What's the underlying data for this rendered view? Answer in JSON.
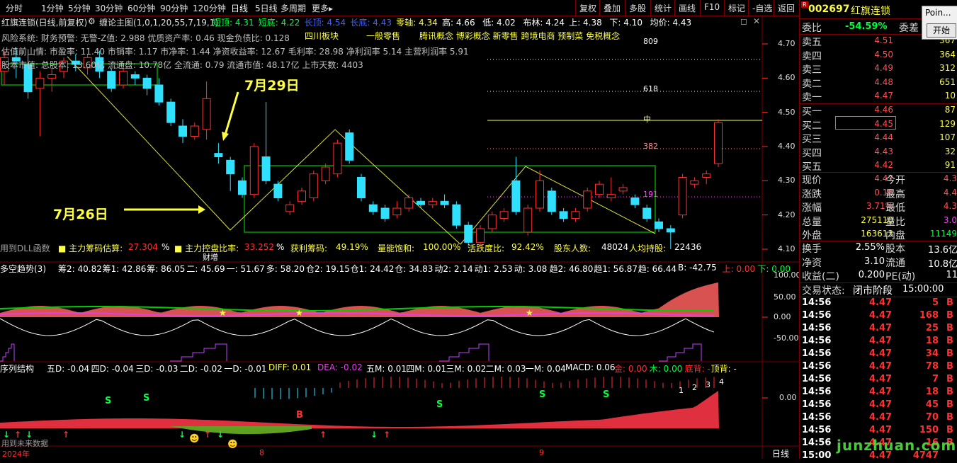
{
  "periods": [
    "分时",
    "1分钟",
    "5分钟",
    "30分钟",
    "60分钟",
    "90分钟",
    "120分钟",
    "日线",
    "5日线",
    "多周期",
    "更多▸"
  ],
  "toolbar": [
    "复权",
    "叠加",
    "多股",
    "统计",
    "画线",
    "F10",
    "标记",
    "-自选",
    "返回"
  ],
  "stock": {
    "code": "002697",
    "name": "红旗连锁",
    "badge": "R"
  },
  "popup": {
    "title": "Poin...",
    "button": "开始"
  },
  "chart_title": "红旗连锁(日线,前复权)",
  "indicator_title": "缠论主图(1,0,1,20,55,7,19,1)",
  "ind_items": [
    "短顶: 4.31",
    "短底: 4.22",
    "长顶: 4.54",
    "长底: 4.43",
    "零轴: 4.34",
    "高: 4.66",
    "低: 4.02",
    "布林: 4.24",
    "上: 4.38",
    "下: 4.10",
    "均价: 4.43"
  ],
  "info_lines": [
    "风险系统: 财务预警: 无警-Z值: 2.988 优质资产率: 0.46 现金负债比: 0.128",
    "估值前山情: 市盈率: 11.40 市销率: 1.17 市净率: 1.44 净资收益率: 12.67 毛利率: 28.98 净利润率 5.14 主营利润率 5.91",
    "股本市值: 总股本: 13.60亿 流通盘: 10.78亿 全流通: 0.79 流通市值: 48.17亿 上市天数: 4403"
  ],
  "concepts": [
    "四川板块",
    "一般零售",
    "腾讯概念 博彩概念 新零售 跨境电商 预制菜 免税概念"
  ],
  "annotations": {
    "jul29": "7月29日",
    "jul26": "7月26日"
  },
  "fib": [
    "809",
    "618",
    "中",
    "382",
    "191"
  ],
  "price_axis": [
    "4.70",
    "4.60",
    "4.50",
    "4.40",
    "4.30",
    "4.20",
    "4.10"
  ],
  "chip_bar": {
    "dll": "用到DLL函数",
    "items": [
      "■ 主力筹码估算:",
      "27.304",
      "%",
      "■ 主力控盘比率:",
      "33.252",
      "%",
      "获利筹码:",
      "49.19%",
      "量能饱和:",
      "100.00%",
      "活跃度比:",
      "92.42%",
      "股东人数:",
      "48024",
      "人均持股:",
      "22436"
    ],
    "tag": "财增"
  },
  "panel2": {
    "title": "多空趋势(3)",
    "items": [
      "筹2: 40.82",
      "筹1: 42.86",
      "筹: 86.05",
      "二: 45.69",
      "一: 51.67",
      "多: 58.20",
      "仓2: 19.15",
      "仓1: 24.42",
      "仓: 34.83",
      "动2: 2.14",
      "动1: 2.53",
      "动: 3.08",
      "趋2: 46.80",
      "趋1: 56.87",
      "趋: 66.44",
      "B: -42.75",
      "上: 0.00",
      "下: 0.00"
    ],
    "axis": [
      "100.00",
      "50.00",
      "0.00",
      "-50.00"
    ]
  },
  "panel3": {
    "title": "序列结构",
    "items": [
      "五D: -0.04",
      "四D: -0.04",
      "三D: -0.03",
      "二D: -0.02",
      "一D: -0.01",
      "DIFF: 0.01",
      "DEA: -0.02",
      "五M: 0.01",
      "四M: 0.01",
      "三M: 0.02",
      "二M: 0.03",
      "一M: 0.04",
      "MACD: 0.06",
      "金: 0.00",
      "木: 0.00",
      "底背: -",
      "顶背: -"
    ],
    "axis": [
      "0.00"
    ],
    "future": "用到未来数据"
  },
  "bottom": {
    "year": "2024年",
    "m8": "8",
    "m9": "9",
    "period": "日线"
  },
  "order_book": {
    "weibi_label": "委比",
    "weibi": "-54.59%",
    "weicha_label": "委差",
    "weicha": "-",
    "sells": [
      {
        "l": "卖五",
        "p": "4.51",
        "v": "367"
      },
      {
        "l": "卖四",
        "p": "4.50",
        "v": "364"
      },
      {
        "l": "卖三",
        "p": "4.49",
        "v": "312"
      },
      {
        "l": "卖二",
        "p": "4.48",
        "v": "651"
      },
      {
        "l": "卖一",
        "p": "4.47",
        "v": "10"
      }
    ],
    "buys": [
      {
        "l": "买一",
        "p": "4.46",
        "v": "87"
      },
      {
        "l": "买二",
        "p": "4.45",
        "v": "129"
      },
      {
        "l": "买三",
        "p": "4.44",
        "v": "107"
      },
      {
        "l": "买四",
        "p": "4.43",
        "v": "32"
      },
      {
        "l": "买五",
        "p": "4.42",
        "v": "91"
      }
    ]
  },
  "quote": [
    {
      "l1": "现价",
      "v1": "4.47",
      "l2": "今开",
      "v2": "4.3"
    },
    {
      "l1": "涨跌",
      "v1": "0.16",
      "l2": "最高",
      "v2": "4.4"
    },
    {
      "l1": "涨幅",
      "v1": "3.71%",
      "l2": "最低",
      "v2": "4.3"
    },
    {
      "l1": "总量",
      "v1": "275110",
      "l2": "量比",
      "v2": "3.0"
    },
    {
      "l1": "外盘",
      "v1": "163613",
      "l2": "内盘",
      "v2": "11149"
    }
  ],
  "fund": [
    {
      "l1": "换手",
      "v1": "2.55%",
      "l2": "股本",
      "v2": "13.6亿"
    },
    {
      "l1": "净资",
      "v1": "3.10",
      "l2": "流通",
      "v2": "10.8亿"
    },
    {
      "l1": "收益(二)",
      "v1": "0.200",
      "l2": "PE(动)",
      "v2": "11"
    }
  ],
  "trade_status": {
    "label": "交易状态:",
    "status": "闭市阶段",
    "time": "15:00:00"
  },
  "ticks": [
    {
      "t": "14:56",
      "p": "4.47",
      "v": "5",
      "d": "B"
    },
    {
      "t": "14:56",
      "p": "4.47",
      "v": "168",
      "d": "B"
    },
    {
      "t": "14:56",
      "p": "4.47",
      "v": "25",
      "d": "B"
    },
    {
      "t": "14:56",
      "p": "4.47",
      "v": "18",
      "d": "B"
    },
    {
      "t": "14:56",
      "p": "4.47",
      "v": "34",
      "d": "B"
    },
    {
      "t": "14:56",
      "p": "4.47",
      "v": "78",
      "d": "B"
    },
    {
      "t": "14:56",
      "p": "4.47",
      "v": "7",
      "d": "B"
    },
    {
      "t": "14:56",
      "p": "4.47",
      "v": "18",
      "d": "B"
    },
    {
      "t": "14:56",
      "p": "4.47",
      "v": "45",
      "d": "B"
    },
    {
      "t": "14:56",
      "p": "4.47",
      "v": "70",
      "d": "B"
    },
    {
      "t": "14:56",
      "p": "4.47",
      "v": "150",
      "d": "B"
    },
    {
      "t": "14:56",
      "p": "4.47",
      "v": "16",
      "d": "B"
    },
    {
      "t": "15:00",
      "p": "4.47",
      "v": "4747",
      "d": ""
    }
  ],
  "watermark": "junzhuan.com",
  "candles": [
    {
      "o": 4.62,
      "c": 4.66,
      "h": 4.68,
      "l": 4.58
    },
    {
      "o": 4.66,
      "c": 4.65,
      "h": 4.69,
      "l": 4.6
    },
    {
      "o": 4.64,
      "c": 4.56,
      "h": 4.67,
      "l": 4.54
    },
    {
      "o": 4.57,
      "c": 4.6,
      "h": 4.62,
      "l": 4.43
    },
    {
      "o": 4.6,
      "c": 4.61,
      "h": 4.63,
      "l": 4.56
    },
    {
      "o": 4.62,
      "c": 4.65,
      "h": 4.66,
      "l": 4.6
    },
    {
      "o": 4.65,
      "c": 4.64,
      "h": 4.67,
      "l": 4.62
    },
    {
      "o": 4.63,
      "c": 4.66,
      "h": 4.67,
      "l": 4.61
    },
    {
      "o": 4.66,
      "c": 4.62,
      "h": 4.68,
      "l": 4.6
    },
    {
      "o": 4.62,
      "c": 4.57,
      "h": 4.63,
      "l": 4.56
    },
    {
      "o": 4.58,
      "c": 4.62,
      "h": 4.63,
      "l": 4.57
    },
    {
      "o": 4.61,
      "c": 4.6,
      "h": 4.62,
      "l": 4.58
    },
    {
      "o": 4.6,
      "c": 4.57,
      "h": 4.61,
      "l": 4.55
    },
    {
      "o": 4.58,
      "c": 4.53,
      "h": 4.6,
      "l": 4.52
    },
    {
      "o": 4.53,
      "c": 4.47,
      "h": 4.54,
      "l": 4.46
    },
    {
      "o": 4.46,
      "c": 4.43,
      "h": 4.48,
      "l": 4.41
    },
    {
      "o": 4.43,
      "c": 4.46,
      "h": 4.47,
      "l": 4.42
    },
    {
      "o": 4.45,
      "c": 4.54,
      "h": 4.59,
      "l": 4.42
    },
    {
      "o": 4.38,
      "c": 4.37,
      "h": 4.41,
      "l": 4.35
    },
    {
      "o": 4.36,
      "c": 4.32,
      "h": 4.37,
      "l": 4.27
    },
    {
      "o": 4.3,
      "c": 4.26,
      "h": 4.31,
      "l": 4.25
    },
    {
      "o": 4.26,
      "c": 4.4,
      "h": 4.41,
      "l": 4.25
    },
    {
      "o": 4.37,
      "c": 4.3,
      "h": 4.53,
      "l": 4.29
    },
    {
      "o": 4.29,
      "c": 4.25,
      "h": 4.3,
      "l": 4.24
    },
    {
      "o": 4.21,
      "c": 4.23,
      "h": 4.24,
      "l": 4.2
    },
    {
      "o": 4.24,
      "c": 4.27,
      "h": 4.28,
      "l": 4.23
    },
    {
      "o": 4.25,
      "c": 4.32,
      "h": 4.33,
      "l": 4.24
    },
    {
      "o": 4.3,
      "c": 4.34,
      "h": 4.35,
      "l": 4.29
    },
    {
      "o": 4.32,
      "c": 4.41,
      "h": 4.42,
      "l": 4.31
    },
    {
      "o": 4.44,
      "c": 4.36,
      "h": 4.45,
      "l": 4.35
    },
    {
      "o": 4.31,
      "c": 4.25,
      "h": 4.32,
      "l": 4.24
    },
    {
      "o": 4.23,
      "c": 4.21,
      "h": 4.24,
      "l": 4.2
    },
    {
      "o": 4.22,
      "c": 4.19,
      "h": 4.23,
      "l": 4.18
    },
    {
      "o": 4.2,
      "c": 4.22,
      "h": 4.24,
      "l": 4.19
    },
    {
      "o": 4.22,
      "c": 4.25,
      "h": 4.26,
      "l": 4.21
    },
    {
      "o": 4.24,
      "c": 4.23,
      "h": 4.25,
      "l": 4.22
    },
    {
      "o": 4.23,
      "c": 4.24,
      "h": 4.25,
      "l": 4.22
    },
    {
      "o": 4.24,
      "c": 4.23,
      "h": 4.26,
      "l": 4.22
    },
    {
      "o": 4.23,
      "c": 4.17,
      "h": 4.24,
      "l": 4.16
    },
    {
      "o": 4.17,
      "c": 4.12,
      "h": 4.18,
      "l": 4.11
    },
    {
      "o": 4.12,
      "c": 4.16,
      "h": 4.17,
      "l": 4.1
    },
    {
      "o": 4.16,
      "c": 4.2,
      "h": 4.21,
      "l": 4.15
    },
    {
      "o": 4.19,
      "c": 4.21,
      "h": 4.22,
      "l": 4.18
    },
    {
      "o": 4.3,
      "c": 4.21,
      "h": 4.37,
      "l": 4.2
    },
    {
      "o": 4.15,
      "c": 4.22,
      "h": 4.23,
      "l": 4.14
    },
    {
      "o": 4.22,
      "c": 4.3,
      "h": 4.33,
      "l": 4.21
    },
    {
      "o": 4.27,
      "c": 4.21,
      "h": 4.28,
      "l": 4.2
    },
    {
      "o": 4.21,
      "c": 4.19,
      "h": 4.22,
      "l": 4.18
    },
    {
      "o": 4.19,
      "c": 4.21,
      "h": 4.22,
      "l": 4.18
    },
    {
      "o": 4.22,
      "c": 4.27,
      "h": 4.28,
      "l": 4.21
    },
    {
      "o": 4.26,
      "c": 4.29,
      "h": 4.3,
      "l": 4.25
    },
    {
      "o": 4.25,
      "c": 4.26,
      "h": 4.31,
      "l": 4.24
    },
    {
      "o": 4.27,
      "c": 4.28,
      "h": 4.29,
      "l": 4.26
    },
    {
      "o": 4.25,
      "c": 4.23,
      "h": 4.26,
      "l": 4.22
    },
    {
      "o": 4.22,
      "c": 4.19,
      "h": 4.23,
      "l": 4.18
    },
    {
      "o": 4.18,
      "c": 4.16,
      "h": 4.19,
      "l": 4.15
    },
    {
      "o": 4.16,
      "c": 4.15,
      "h": 4.17,
      "l": 4.1
    },
    {
      "o": 4.2,
      "c": 4.31,
      "h": 4.32,
      "l": 4.19
    },
    {
      "o": 4.29,
      "c": 4.3,
      "h": 4.31,
      "l": 4.28
    },
    {
      "o": 4.31,
      "c": 4.32,
      "h": 4.33,
      "l": 4.29
    },
    {
      "o": 4.35,
      "c": 4.47,
      "h": 4.48,
      "l": 4.34
    }
  ]
}
